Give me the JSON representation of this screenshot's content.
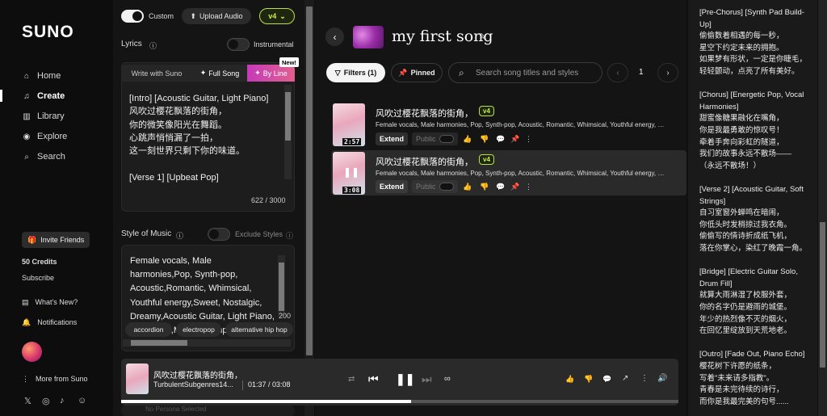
{
  "nav": {
    "logo": "SUNO",
    "items": [
      {
        "label": "Home",
        "icon": "home-icon"
      },
      {
        "label": "Create",
        "icon": "music-note-icon"
      },
      {
        "label": "Library",
        "icon": "library-icon"
      },
      {
        "label": "Explore",
        "icon": "compass-icon"
      },
      {
        "label": "Search",
        "icon": "search-icon"
      }
    ],
    "invite": "Invite Friends",
    "credits": "50 Credits",
    "subscribe": "Subscribe",
    "whats_new": "What's New?",
    "notifications": "Notifications",
    "more": "More from Suno"
  },
  "create": {
    "custom_label": "Custom",
    "upload_label": "Upload Audio",
    "model": "v4",
    "lyrics_label": "Lyrics",
    "instrumental_label": "Instrumental",
    "tabs": [
      "Write with Suno",
      "Full Song",
      "By Line"
    ],
    "new_badge": "New!",
    "lyrics_text": "[Intro] [Acoustic Guitar, Light Piano]\n风吹过樱花飘落的街角，\n你的微笑像阳光在舞蹈。\n心跳声悄悄漏了一拍，\n这一刻世界只剩下你的味道。\n\n[Verse 1] [Upbeat Pop]",
    "char_count": "622 / 3000",
    "style_label": "Style of Music",
    "exclude_label": "Exclude Styles",
    "style_text": "Female vocals, Male harmonies,Pop, Synth-pop, Acoustic,Romantic, Whimsical, Youthful energy,Sweet, Nostalgic, Dreamy,Acoustic Guitar, Light Piano, Synth Pad,Medium tempo",
    "style_count": "200",
    "tags": [
      "accordion",
      "electropop",
      "alternative hip hop"
    ]
  },
  "main": {
    "title": "my first song",
    "filters_label": "Filters (1)",
    "pinned_label": "Pinned",
    "search_placeholder": "Search song titles and styles",
    "page": "1",
    "songs": [
      {
        "title": "风吹过樱花飘落的街角，",
        "version": "v4",
        "styles": "Female vocals, Male harmonies, Pop, Synth-pop, Acoustic, Romantic, Whimsical, Youthful energy, Swe...",
        "duration": "2:57",
        "extend": "Extend",
        "public": "Public"
      },
      {
        "title": "风吹过樱花飘落的街角，",
        "version": "v4",
        "styles": "Female vocals, Male harmonies, Pop, Synth-pop, Acoustic, Romantic, Whimsical, Youthful energy, Swe...",
        "duration": "3:08",
        "extend": "Extend",
        "public": "Public"
      }
    ]
  },
  "lyrics_panel": {
    "lines": [
      "[Pre-Chorus] [Synth Pad Build-",
      "Up]",
      "偷偷数着相遇的每一秒，",
      "星空下约定未来的拥抱。",
      "如果梦有形状，一定是你睫毛，",
      "轻轻颤动，点亮了所有美好。",
      "",
      "[Chorus] [Energetic Pop, Vocal",
      "Harmonies]",
      "甜蜜像糖果融化在嘴角，",
      "你是我最勇敢的惊叹号！",
      "牵着手奔向彩虹的隧道，",
      "我们的故事永远不散场——",
      "（永远不散场！）",
      "",
      "[Verse 2] [Acoustic Guitar, Soft",
      "Strings]",
      "自习室窗外蝉鸣在暗闹，",
      "你低头时发梢掠过我衣角。",
      "偷偷写的情诗折成纸飞机，",
      "落在你掌心，染红了晚霞一角。",
      "",
      "[Bridge] [Electric Guitar Solo,",
      "Drum Fill]",
      "就算大雨淋湿了校服外套，",
      "你的名字仍是避雨的城堡。",
      "年少的热烈像不灭的烟火，",
      "在回忆里绽放到天荒地老。",
      "",
      "[Outro] [Fade Out, Piano Echo]",
      "樱花树下许愿的纸条，",
      "写着\"未来请多指教\"。",
      "青春是未完待续的诗行，",
      "而你是我最完美的句号......"
    ]
  },
  "player": {
    "title": "风吹过樱花飘落的街角，",
    "subtitle": "TurbulentSubgenres14...",
    "time": "01:37 / 03:08",
    "progress": 0.52,
    "hidden_label": "No Persona Selected"
  }
}
